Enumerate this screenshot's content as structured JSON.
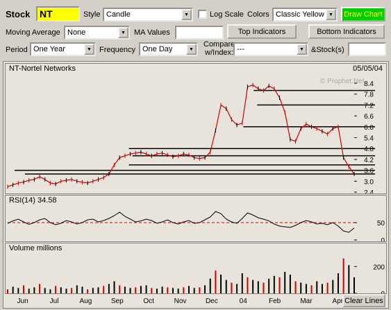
{
  "toolbar": {
    "stock_label": "Stock",
    "stock_value": "NT",
    "style_label": "Style",
    "style_value": "Candle",
    "log_scale_label": "Log Scale",
    "log_scale_checked": false,
    "colors_label": "Colors",
    "colors_value": "Classic Yellow",
    "draw_chart_label": "Draw Chart",
    "moving_average_label": "Moving Average",
    "moving_average_value": "None",
    "ma_values_label": "MA Values",
    "ma_values_value": "",
    "top_indicators_label": "Top Indicators",
    "bottom_indicators_label": "Bottom Indicators",
    "period_label": "Period",
    "period_value": "One Year",
    "frequency_label": "Frequency",
    "frequency_value": "One Day",
    "compare_label_1": "Compare",
    "compare_label_2": "w/Index:",
    "compare_value": "---",
    "stocks_label": "&Stock(s)",
    "stocks_value": ""
  },
  "price_panel": {
    "title": "NT-Nortel Networks",
    "date": "05/05/04",
    "watermark": "© Prophet.Net"
  },
  "rsi_panel": {
    "title": "RSI(14) 34.58"
  },
  "volume_panel": {
    "title": "Volume  millions"
  },
  "clear_lines_label": "Clear Lines",
  "colors": {
    "accent_yellow": "#ffff00",
    "draw_chart_green": "#00cc00",
    "line_black": "#000000",
    "ref_red": "#cc0000",
    "candle_up": "#000000",
    "candle_down": "#cc0000"
  },
  "chart_data": [
    {
      "type": "line",
      "title": "NT-Nortel Networks",
      "x_tick_labels": [
        "Jun",
        "Jul",
        "Aug",
        "Sep",
        "Oct",
        "Nov",
        "Dec",
        "04",
        "Feb",
        "Mar",
        "Apr"
      ],
      "y_tick_labels": [
        "8.4",
        "7.8",
        "7.2",
        "6.6",
        "6.0",
        "5.4",
        "4.8",
        "4.2",
        "3.6",
        "3.0",
        "2.4"
      ],
      "ylim": [
        2.4,
        8.4
      ],
      "series": [
        {
          "values": [
            2.7,
            2.8,
            2.9,
            2.95,
            3.05,
            3.1,
            3.25,
            3.1,
            2.9,
            2.85,
            3.0,
            3.05,
            3.1,
            3.0,
            2.95,
            2.9,
            3.0,
            3.1,
            3.2,
            3.4,
            3.9,
            4.3,
            4.4,
            4.5,
            4.55,
            4.6,
            4.5,
            4.4,
            4.5,
            4.55,
            4.45,
            4.35,
            4.4,
            4.5,
            4.45,
            4.3,
            4.25,
            4.3,
            4.6,
            5.8,
            7.2,
            7.0,
            6.4,
            6.1,
            6.2,
            8.2,
            8.3,
            8.1,
            8.0,
            8.25,
            8.1,
            7.6,
            6.8,
            5.3,
            5.2,
            5.9,
            6.15,
            6.0,
            5.9,
            5.75,
            5.6,
            5.9,
            6.0,
            4.3,
            3.8,
            3.4
          ]
        }
      ],
      "horizontal_lines": [
        3.4,
        3.6,
        3.9,
        4.4,
        4.8,
        6.0,
        7.2,
        8.0
      ]
    },
    {
      "type": "line",
      "title": "RSI(14) 34.58",
      "y_tick_labels": [
        "50",
        "0"
      ],
      "ylim": [
        0,
        100
      ],
      "reference_level": 50,
      "series": [
        {
          "values": [
            48,
            55,
            60,
            52,
            45,
            50,
            58,
            62,
            50,
            44,
            48,
            56,
            52,
            46,
            50,
            58,
            60,
            52,
            56,
            62,
            70,
            80,
            68,
            60,
            52,
            55,
            60,
            56,
            48,
            52,
            58,
            50,
            46,
            52,
            56,
            48,
            50,
            58,
            66,
            82,
            76,
            60,
            52,
            48,
            62,
            78,
            72,
            64,
            60,
            55,
            46,
            40,
            38,
            36,
            42,
            50,
            56,
            52,
            46,
            48,
            44,
            50,
            40,
            26,
            22,
            34.58
          ]
        }
      ]
    },
    {
      "type": "bar",
      "title": "Volume  millions",
      "y_tick_labels": [
        "200",
        "0"
      ],
      "ylim": [
        0,
        300
      ],
      "series": [
        {
          "values": [
            30,
            50,
            40,
            60,
            35,
            45,
            70,
            40,
            30,
            55,
            45,
            35,
            40,
            60,
            50,
            30,
            40,
            45,
            55,
            70,
            90,
            60,
            50,
            40,
            45,
            55,
            60,
            40,
            35,
            50,
            45,
            40,
            35,
            45,
            55,
            40,
            45,
            60,
            110,
            170,
            140,
            100,
            80,
            70,
            150,
            120,
            100,
            90,
            80,
            110,
            130,
            120,
            160,
            140,
            90,
            80,
            70,
            60,
            90,
            70,
            80,
            100,
            150,
            260,
            210,
            120
          ]
        }
      ]
    }
  ]
}
